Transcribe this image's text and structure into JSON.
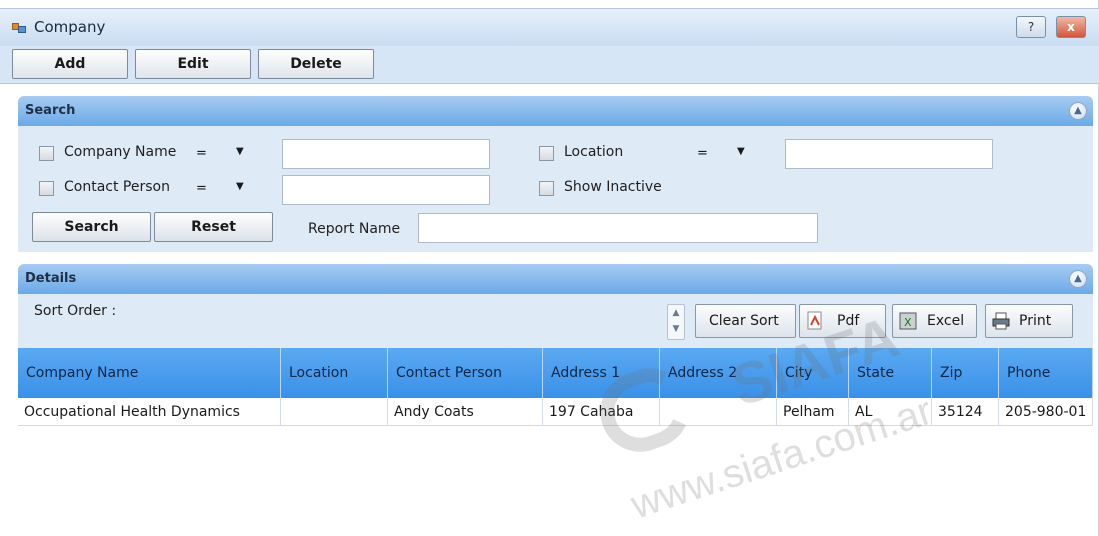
{
  "window": {
    "title": "Company",
    "help_label": "?",
    "close_label": "x"
  },
  "toolbar": {
    "add_label": "Add",
    "edit_label": "Edit",
    "delete_label": "Delete"
  },
  "search": {
    "header": "Search",
    "company_name_label": "Company Name",
    "company_name_op": "=",
    "contact_person_label": "Contact Person",
    "contact_person_op": "=",
    "location_label": "Location",
    "location_op": "=",
    "show_inactive_label": "Show Inactive",
    "search_button": "Search",
    "reset_button": "Reset",
    "report_name_label": "Report Name"
  },
  "details": {
    "header": "Details",
    "sort_order_label": "Sort Order :",
    "clear_sort_label": "Clear Sort",
    "pdf_label": "Pdf",
    "excel_label": "Excel",
    "print_label": "Print",
    "columns": [
      "Company Name",
      "Location",
      "Contact Person",
      "Address 1",
      "Address 2",
      "City",
      "State",
      "Zip",
      "Phone"
    ],
    "rows": [
      [
        "Occupational Health Dynamics",
        "",
        "Andy Coats",
        "197 Cahaba",
        "",
        "Pelham",
        "AL",
        "35124",
        "205-980-01"
      ]
    ]
  },
  "watermark": {
    "logo": "SIAFA",
    "url": "www.siafa.com.ar"
  },
  "colors": {
    "header_blue": "#3a91e8",
    "section_blue": "#6aa9e8",
    "panel_bg": "#dfeaf7"
  },
  "icons": [
    "app-icon",
    "help-icon",
    "close-icon",
    "collapse-icon",
    "pdf-icon",
    "excel-icon",
    "print-icon",
    "chevron-down-icon"
  ]
}
